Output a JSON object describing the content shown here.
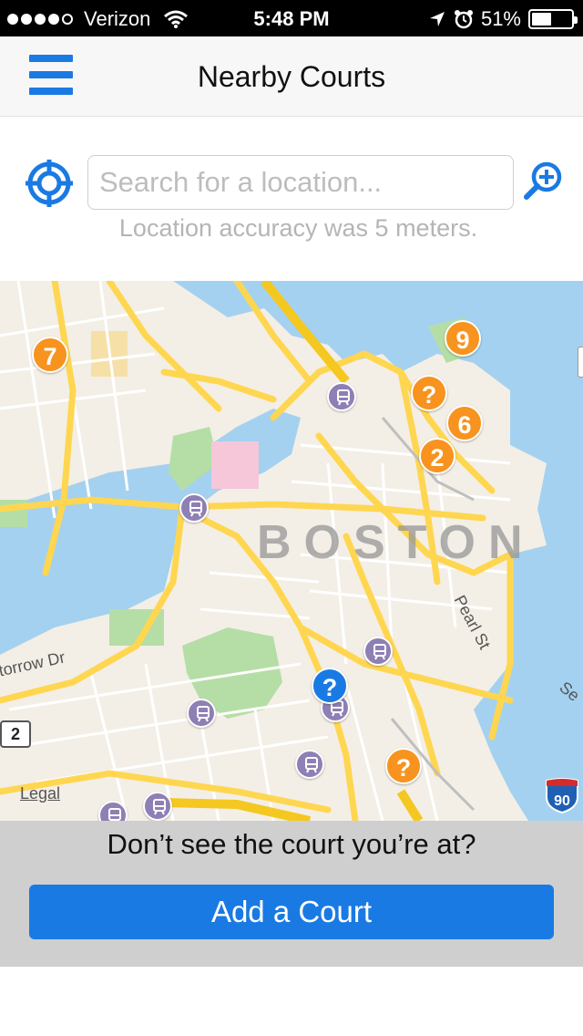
{
  "status_bar": {
    "carrier": "Verizon",
    "time": "5:48 PM",
    "battery": "51%",
    "battery_level": 0.51
  },
  "nav": {
    "title": "Nearby Courts"
  },
  "search": {
    "placeholder": "Search for a location...",
    "value": "",
    "accuracy_text": "Location accuracy was 5 meters."
  },
  "map": {
    "city_label": "BOSTON",
    "street_labels": [
      "Pearl St",
      "torrow Dr",
      "Se"
    ],
    "route_number": "2",
    "interstate_number": "90",
    "legal_label": "Legal",
    "court_pins": [
      {
        "label": "7",
        "color": "#f7931e"
      },
      {
        "label": "9",
        "color": "#f7931e"
      },
      {
        "label": "?",
        "color": "#f7931e"
      },
      {
        "label": "6",
        "color": "#f7931e"
      },
      {
        "label": "2",
        "color": "#f7931e"
      },
      {
        "label": "?",
        "color": "#1a7ae3"
      },
      {
        "label": "?",
        "color": "#f7931e"
      }
    ]
  },
  "bottom": {
    "prompt": "Don’t see the court you’re at?",
    "add_button": "Add a Court"
  },
  "colors": {
    "accent": "#1a7ae3",
    "pin_orange": "#f7931e",
    "transit_purple": "#8e7fb4",
    "water": "#a4d1ef",
    "land": "#f3efe6",
    "park": "#b5dea6",
    "road_yellow": "#ffd650"
  }
}
